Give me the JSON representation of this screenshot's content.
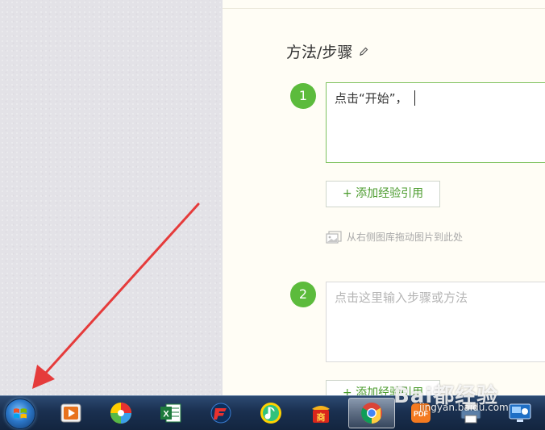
{
  "editor": {
    "section_title": "方法/步骤",
    "steps": [
      {
        "number": "1",
        "text": "点击“开始”，",
        "placeholder": ""
      },
      {
        "number": "2",
        "text": "",
        "placeholder": "点击这里输入步骤或方法"
      }
    ],
    "add_reference_label": "+ 添加经验引用",
    "drag_image_hint": "从右侧图库拖动图片到此处"
  },
  "watermark": {
    "main": "Bai都经验",
    "sub": "jingyan.baidu.com"
  },
  "taskbar": {
    "apps": [
      {
        "name": "media-player-icon",
        "active": false
      },
      {
        "name": "colorful-ball-app-icon",
        "active": false
      },
      {
        "name": "excel-icon",
        "active": false
      },
      {
        "name": "foxit-icon",
        "active": false
      },
      {
        "name": "qq-music-icon",
        "active": false
      },
      {
        "name": "red-packet-icon",
        "active": false
      },
      {
        "name": "chrome-icon",
        "active": true
      },
      {
        "name": "pdf-app-icon",
        "active": false
      },
      {
        "name": "printer-icon",
        "active": false
      },
      {
        "name": "remote-desktop-icon",
        "active": false
      }
    ],
    "icon_labels": {
      "excel": "X",
      "red_packet": "商",
      "pdf": "PDF"
    }
  },
  "colors": {
    "accent_green": "#5cbb3c",
    "annotation_arrow": "#e53b3b"
  }
}
